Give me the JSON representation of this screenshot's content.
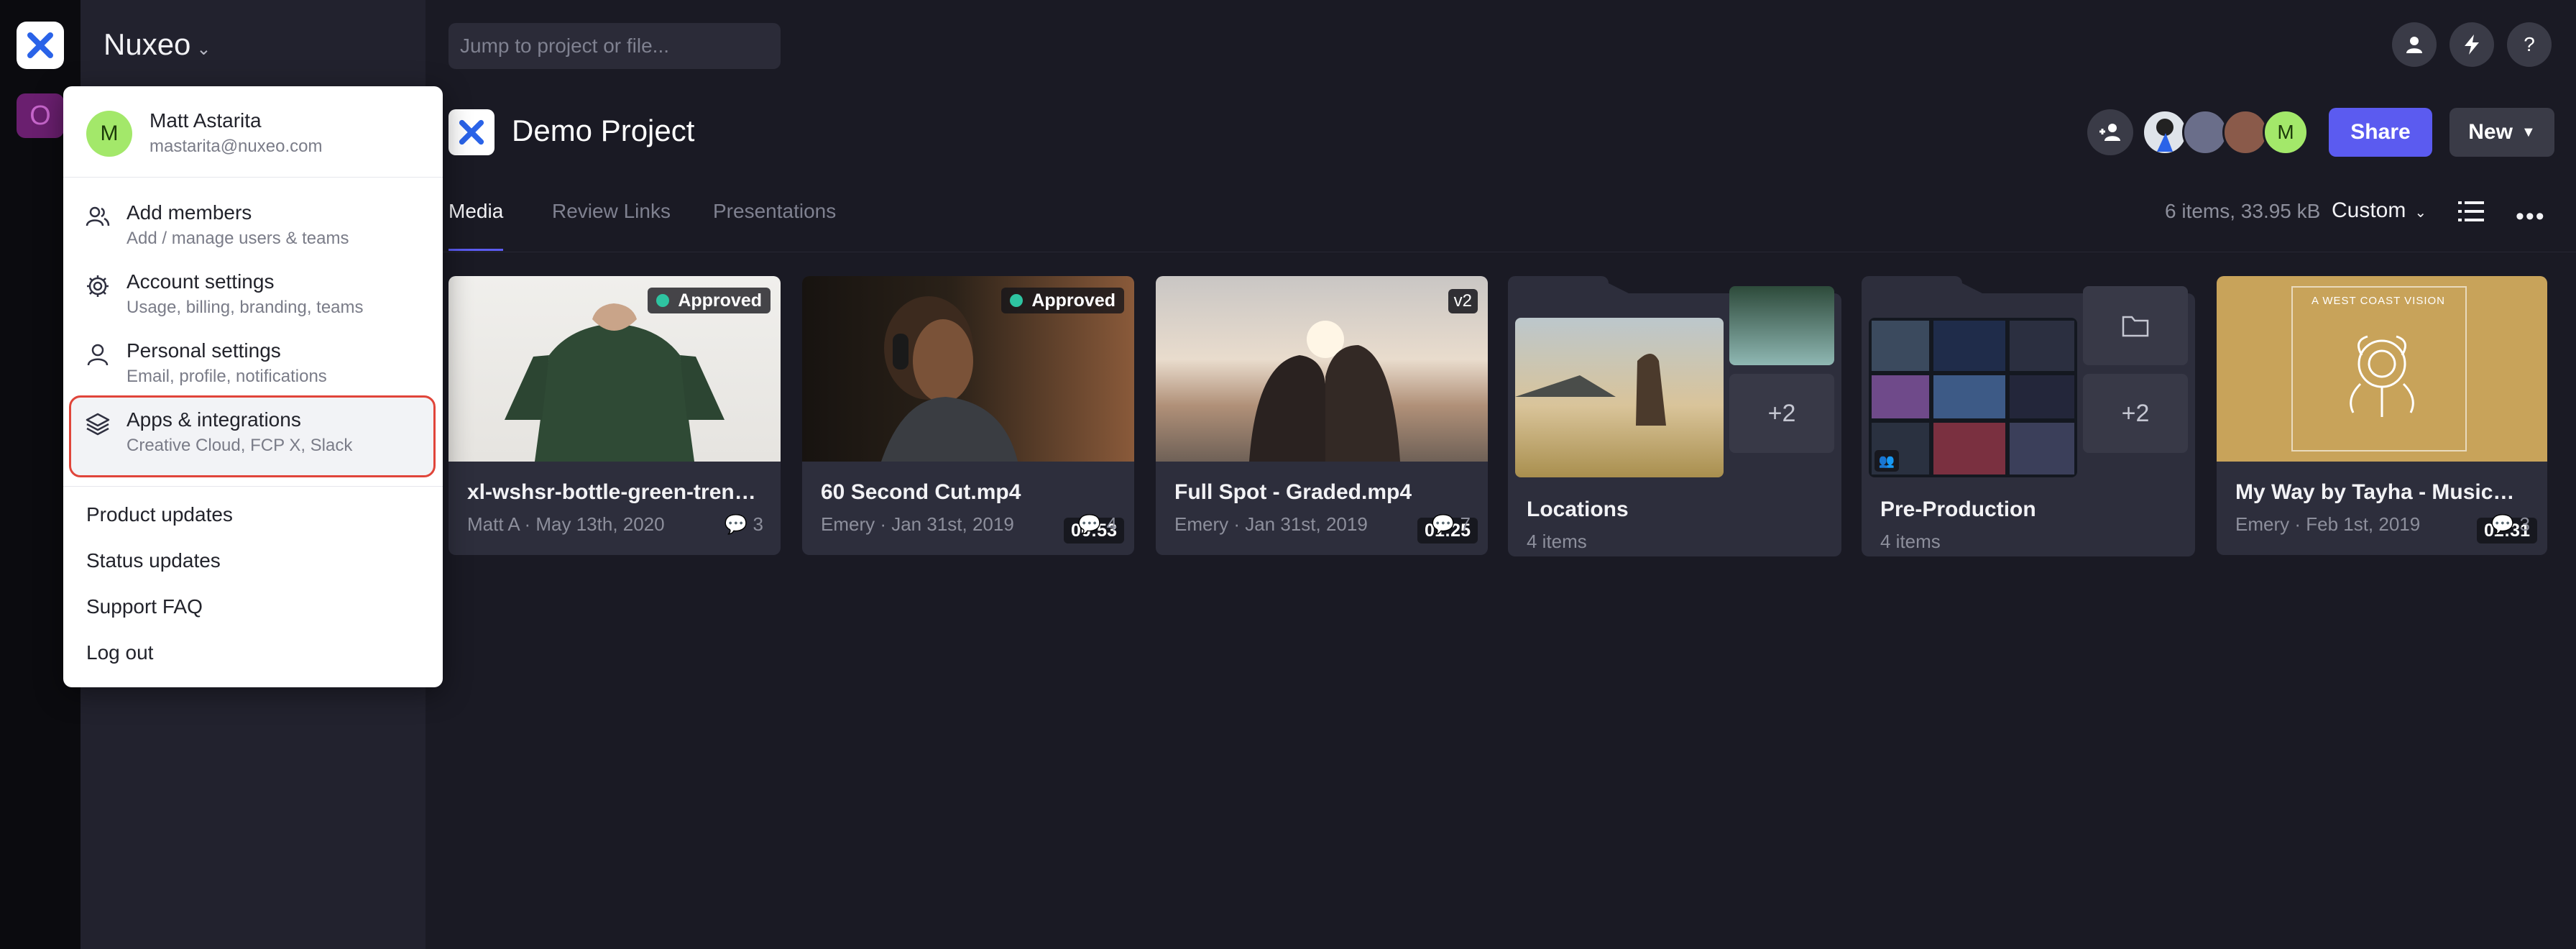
{
  "team": {
    "name": "Nuxeo"
  },
  "rail": {
    "project_initial": "O"
  },
  "search": {
    "placeholder": "Jump to project or file..."
  },
  "header_buttons": [
    "user-icon",
    "bolt-icon",
    "help-icon"
  ],
  "project": {
    "title": "Demo Project"
  },
  "collaborators": {
    "last_initial": "M"
  },
  "actions": {
    "share": "Share",
    "new": "New"
  },
  "tabs": [
    {
      "label": "Media",
      "active": true
    },
    {
      "label": "Review Links",
      "active": false
    },
    {
      "label": "Presentations",
      "active": false
    }
  ],
  "summary": "6 items, 33.95 kB",
  "sort": "Custom",
  "assets": [
    {
      "title": "xl-wshsr-bottle-green-trend...",
      "meta": "Matt A · May 13th, 2020",
      "comments": "3",
      "badge": "Approved"
    },
    {
      "title": "60 Second Cut.mp4",
      "meta": "Emery · Jan 31st, 2019",
      "comments": "4",
      "badge": "Approved",
      "duration": "00:53"
    },
    {
      "title": "Full Spot - Graded.mp4",
      "meta": "Emery · Jan 31st, 2019",
      "comments": "7",
      "version": "v2",
      "duration": "01:25"
    },
    {
      "title": "Locations",
      "meta": "4 items",
      "more": "+2"
    },
    {
      "title": "Pre-Production",
      "meta": "4 items",
      "more": "+2"
    },
    {
      "title": "My Way by Tayha - MusicBe...",
      "meta": "Emery · Feb 1st, 2019",
      "comments": "3",
      "duration": "02:31",
      "art_text": "A WEST COAST VISION"
    }
  ],
  "menu": {
    "user": {
      "initial": "M",
      "name": "Matt Astarita",
      "email": "mastarita@nuxeo.com"
    },
    "items": [
      {
        "label": "Add members",
        "sub": "Add / manage users & teams",
        "icon": "members-icon"
      },
      {
        "label": "Account settings",
        "sub": "Usage, billing, branding, teams",
        "icon": "gear-icon"
      },
      {
        "label": "Personal settings",
        "sub": "Email, profile, notifications",
        "icon": "person-icon"
      },
      {
        "label": "Apps & integrations",
        "sub": "Creative Cloud, FCP X, Slack",
        "icon": "layers-icon",
        "highlighted": true
      }
    ],
    "links": [
      "Product updates",
      "Status updates",
      "Support FAQ",
      "Log out"
    ]
  },
  "colors": {
    "accent": "#5b5bf0",
    "approved": "#2ec4a1",
    "highlight_border": "#e0453a"
  }
}
